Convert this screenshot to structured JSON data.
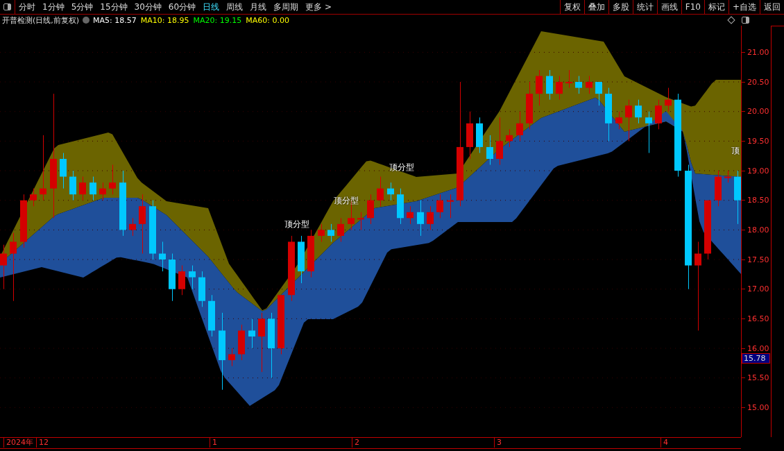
{
  "toolbar": {
    "periods": [
      {
        "label": "分时",
        "selected": false
      },
      {
        "label": "1分钟",
        "selected": false
      },
      {
        "label": "5分钟",
        "selected": false
      },
      {
        "label": "15分钟",
        "selected": false
      },
      {
        "label": "30分钟",
        "selected": false
      },
      {
        "label": "60分钟",
        "selected": false
      },
      {
        "label": "日线",
        "selected": true
      },
      {
        "label": "周线",
        "selected": false
      },
      {
        "label": "月线",
        "selected": false
      },
      {
        "label": "多周期",
        "selected": false
      },
      {
        "label": "更多 >",
        "selected": false
      }
    ],
    "actions": [
      "复权",
      "叠加",
      "多股",
      "统计",
      "画线",
      "F10",
      "标记",
      "+自选",
      "返回"
    ]
  },
  "indicator_line": {
    "title": "开普检测(日线,前复权)",
    "averages": [
      {
        "label": "MA5: 18.57",
        "color": "#ffffff"
      },
      {
        "label": "MA10: 18.95",
        "color": "#ffff00"
      },
      {
        "label": "MA20: 19.15",
        "color": "#00ff00"
      },
      {
        "label": "MA60: 0.00",
        "color": "#ffff00"
      }
    ]
  },
  "chart_data": {
    "type": "candlestick",
    "grid": true,
    "ylim": [
      14.5,
      21.45
    ],
    "yticks": [
      {
        "value": 21,
        "label": "21.00"
      },
      {
        "value": 20.5,
        "label": "20.50"
      },
      {
        "value": 20,
        "label": "20.00"
      },
      {
        "value": 19.5,
        "label": "19.50"
      },
      {
        "value": 19,
        "label": "19.00"
      },
      {
        "value": 18.5,
        "label": "18.50"
      },
      {
        "value": 18,
        "label": "18.00"
      },
      {
        "value": 17.5,
        "label": "17.50"
      },
      {
        "value": 17,
        "label": "17.00"
      },
      {
        "value": 16.5,
        "label": "16.50"
      },
      {
        "value": 16,
        "label": "16.00"
      },
      {
        "value": 15.5,
        "label": "15.50"
      },
      {
        "value": 15,
        "label": "15.00"
      }
    ],
    "annotations": [
      "顶分型",
      "顶分型",
      "顶分型",
      "顶"
    ],
    "ohlc": [
      [
        17.4,
        17.75,
        17.0,
        17.6
      ],
      [
        17.6,
        17.95,
        16.8,
        17.8
      ],
      [
        17.8,
        18.6,
        17.7,
        18.5
      ],
      [
        18.5,
        18.7,
        18.4,
        18.6
      ],
      [
        18.6,
        19.6,
        18.5,
        18.7
      ],
      [
        18.7,
        20.3,
        18.2,
        19.2
      ],
      [
        19.2,
        19.3,
        18.7,
        18.9
      ],
      [
        18.9,
        19.0,
        18.5,
        18.6
      ],
      [
        18.6,
        18.9,
        18.5,
        18.8
      ],
      [
        18.8,
        18.9,
        18.5,
        18.6
      ],
      [
        18.6,
        18.8,
        18.5,
        18.7
      ],
      [
        18.7,
        19.1,
        18.6,
        18.8
      ],
      [
        18.8,
        19.0,
        17.9,
        18.0
      ],
      [
        18.0,
        18.2,
        17.9,
        18.1
      ],
      [
        18.1,
        18.6,
        17.6,
        18.4
      ],
      [
        18.4,
        18.5,
        17.5,
        17.6
      ],
      [
        17.6,
        17.8,
        17.3,
        17.5
      ],
      [
        17.5,
        17.6,
        16.8,
        17.0
      ],
      [
        17.0,
        17.4,
        16.9,
        17.3
      ],
      [
        17.3,
        17.4,
        17.0,
        17.2
      ],
      [
        17.2,
        17.3,
        16.7,
        16.8
      ],
      [
        16.8,
        16.9,
        16.2,
        16.3
      ],
      [
        16.3,
        16.6,
        15.3,
        15.8
      ],
      [
        15.8,
        16.0,
        15.7,
        15.9
      ],
      [
        15.9,
        16.4,
        15.8,
        16.3
      ],
      [
        16.3,
        16.5,
        16.0,
        16.2
      ],
      [
        16.2,
        16.6,
        15.6,
        16.5
      ],
      [
        16.5,
        16.6,
        15.5,
        16.0
      ],
      [
        16.0,
        16.9,
        15.9,
        16.9
      ],
      [
        16.9,
        17.9,
        16.8,
        17.8
      ],
      [
        17.8,
        17.9,
        17.1,
        17.3
      ],
      [
        17.3,
        18.0,
        17.2,
        17.9
      ],
      [
        17.9,
        18.1,
        17.8,
        18.0
      ],
      [
        18.0,
        18.1,
        17.8,
        17.9
      ],
      [
        17.9,
        18.2,
        17.8,
        18.1
      ],
      [
        18.1,
        18.5,
        18.0,
        18.2
      ],
      [
        18.2,
        18.3,
        18.0,
        18.2
      ],
      [
        18.2,
        18.6,
        18.1,
        18.5
      ],
      [
        18.5,
        18.9,
        18.4,
        18.7
      ],
      [
        18.7,
        18.8,
        18.5,
        18.6
      ],
      [
        18.6,
        18.7,
        18.1,
        18.2
      ],
      [
        18.2,
        18.4,
        18.1,
        18.3
      ],
      [
        18.3,
        18.5,
        17.9,
        18.1
      ],
      [
        18.1,
        18.4,
        18.0,
        18.3
      ],
      [
        18.3,
        18.6,
        18.2,
        18.5
      ],
      [
        18.5,
        18.6,
        18.2,
        18.5
      ],
      [
        18.5,
        20.5,
        18.4,
        19.4
      ],
      [
        19.4,
        20.0,
        19.2,
        19.8
      ],
      [
        19.8,
        19.9,
        19.3,
        19.4
      ],
      [
        19.4,
        19.6,
        19.1,
        19.2
      ],
      [
        19.2,
        19.9,
        19.1,
        19.5
      ],
      [
        19.5,
        19.7,
        19.4,
        19.6
      ],
      [
        19.6,
        20.0,
        19.5,
        19.8
      ],
      [
        19.8,
        20.5,
        19.7,
        20.3
      ],
      [
        20.3,
        20.7,
        20.1,
        20.6
      ],
      [
        20.6,
        20.7,
        20.2,
        20.3
      ],
      [
        20.3,
        20.6,
        20.2,
        20.5
      ],
      [
        20.5,
        20.7,
        20.4,
        20.5
      ],
      [
        20.5,
        20.6,
        20.3,
        20.4
      ],
      [
        20.4,
        20.6,
        20.3,
        20.5
      ],
      [
        20.5,
        20.5,
        20.1,
        20.3
      ],
      [
        20.3,
        20.4,
        19.5,
        19.8
      ],
      [
        19.8,
        20.0,
        19.7,
        19.9
      ],
      [
        19.9,
        20.2,
        19.5,
        20.1
      ],
      [
        20.1,
        20.2,
        19.8,
        19.9
      ],
      [
        19.9,
        20.0,
        19.3,
        19.8
      ],
      [
        19.8,
        20.2,
        19.7,
        20.1
      ],
      [
        20.1,
        20.4,
        20.0,
        20.2
      ],
      [
        20.2,
        20.3,
        18.9,
        19.0
      ],
      [
        19.0,
        19.1,
        17.0,
        17.4
      ],
      [
        17.4,
        17.8,
        16.3,
        17.6
      ],
      [
        17.6,
        18.5,
        17.5,
        18.5
      ],
      [
        18.5,
        19.0,
        18.4,
        18.9
      ],
      [
        18.9,
        19.0,
        18.8,
        18.9
      ],
      [
        18.9,
        19.0,
        18.1,
        18.5
      ]
    ]
  },
  "current_price": "15.78",
  "date_axis": [
    "2024年",
    "12",
    "1",
    "2",
    "3",
    "4"
  ]
}
